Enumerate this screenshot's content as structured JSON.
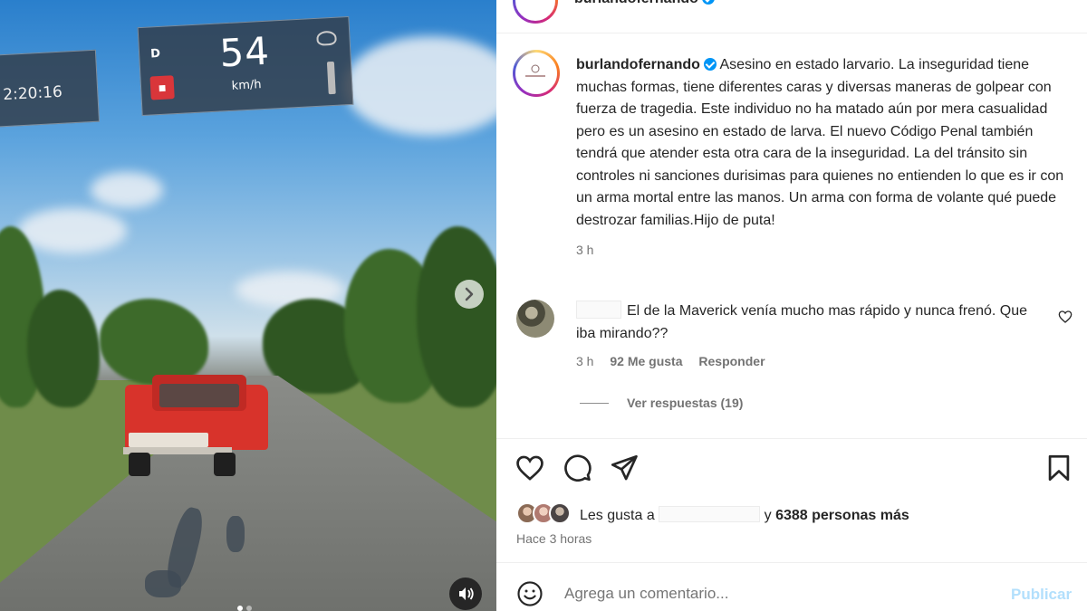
{
  "media": {
    "hud": {
      "time": "2:20:16",
      "gear": "D",
      "speed": "54",
      "unit": "km/h"
    },
    "carousel": {
      "total": 2,
      "active": 1
    },
    "icons": {
      "next": "chevron-right-icon",
      "sound": "speaker-icon",
      "seatbelt": "seatbelt-warning-icon"
    }
  },
  "header": {
    "username": "burlandofernando",
    "verified": true
  },
  "caption": {
    "username": "burlandofernando",
    "text": "Asesino en estado larvario. La inseguridad tiene muchas formas, tiene diferentes caras y diversas maneras de golpear con fuerza de tragedia. Este individuo no ha matado aún por mera casualidad pero es un asesino en estado de larva. El nuevo Código Penal también tendrá que atender esta otra cara de la inseguridad. La del tránsito sin controles ni sanciones durisimas para quienes no entienden lo que es ir con un arma mortal entre las manos. Un arma con forma de volante qué puede destrozar familias.Hijo de puta!",
    "time": "3 h"
  },
  "comment": {
    "text": "El de la Maverick venía mucho mas rápido y nunca frenó. Que iba mirando??",
    "time": "3 h",
    "likes": "92 Me gusta",
    "reply": "Responder",
    "view_replies": "Ver respuestas (19)"
  },
  "likes": {
    "prefix": "Les gusta a",
    "suffix": "y",
    "count": "6388 personas más",
    "time_ago": "Hace 3 horas"
  },
  "composer": {
    "placeholder": "Agrega un comentario...",
    "publish": "Publicar"
  },
  "colors": {
    "accent": "#0095f6",
    "publish_disabled": "#b2dffc",
    "muted": "#737373"
  }
}
